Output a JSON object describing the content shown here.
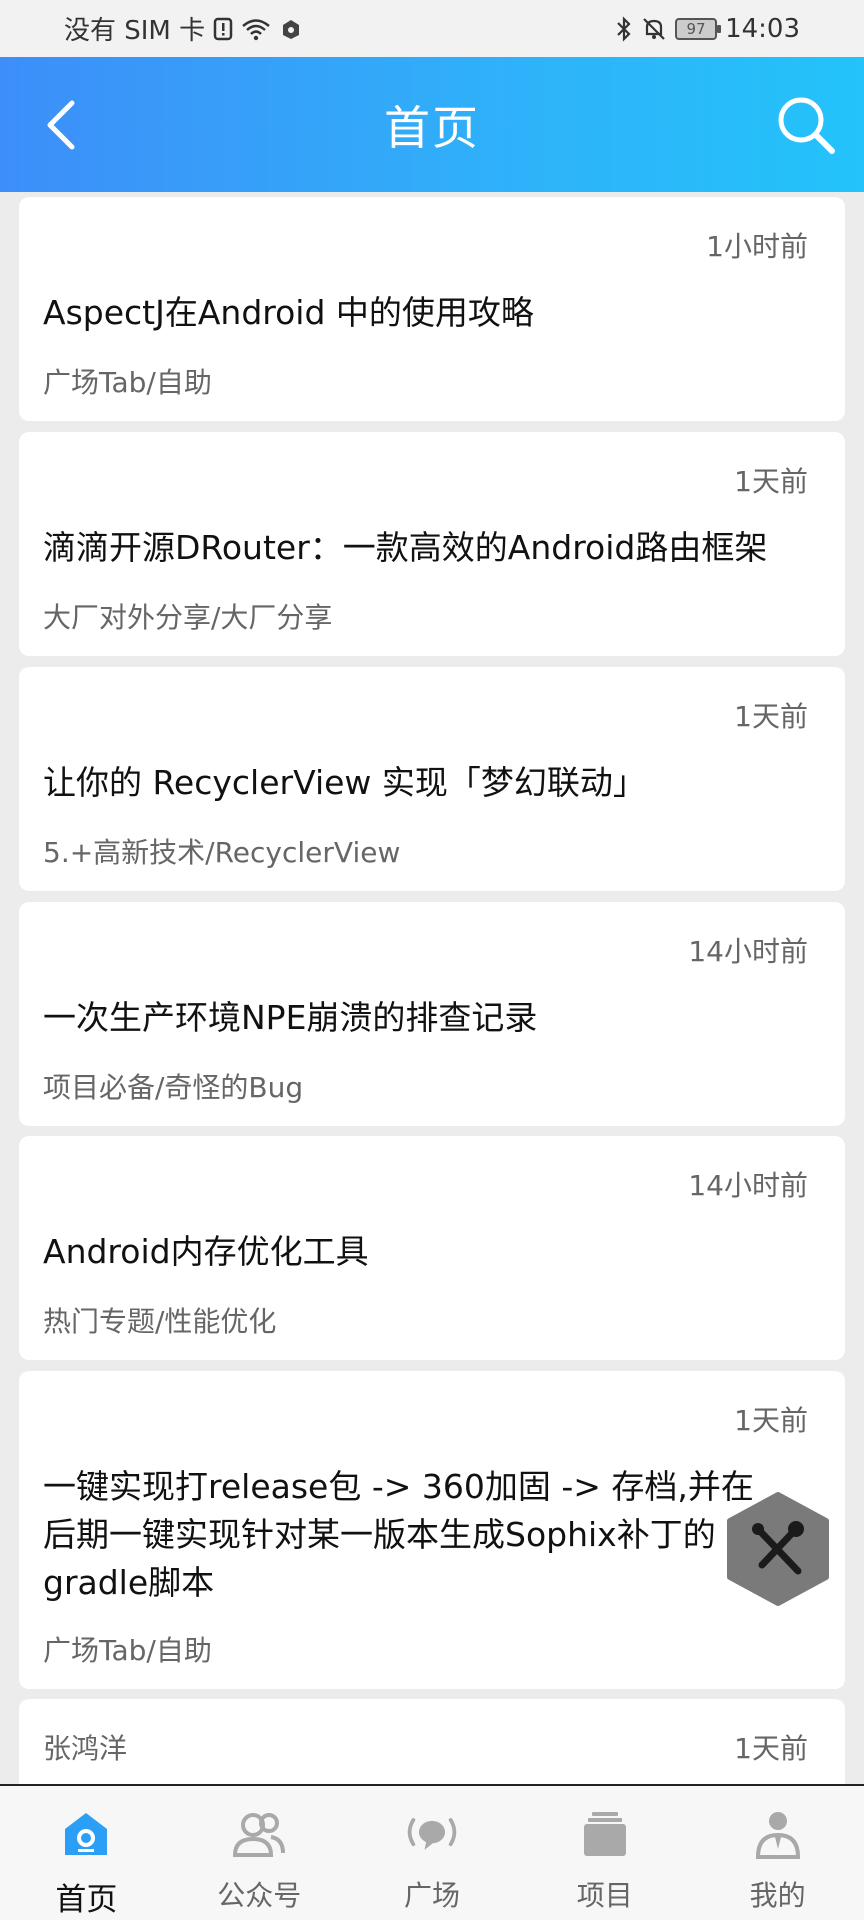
{
  "status_bar": {
    "carrier": "没有 SIM 卡",
    "battery": "97",
    "time": "14:03"
  },
  "header": {
    "title": "首页",
    "back_icon": "chevron-left-icon",
    "search_icon": "search-icon"
  },
  "colors": {
    "header_gradient_start": "#3d8ef9",
    "header_gradient_end": "#23c3fb",
    "nav_active": "#2b9ff5",
    "nav_inactive": "#a9a9a9",
    "fab": "#7a7a7a"
  },
  "feed": {
    "articles": [
      {
        "time": "1小时前",
        "title": "AspectJ在Android 中的使用攻略",
        "category": "广场Tab/自助"
      },
      {
        "time": "1天前",
        "title": "滴滴开源DRouter：一款高效的Android路由框架",
        "category": "大厂对外分享/大厂分享"
      },
      {
        "time": "1天前",
        "title": "让你的 RecyclerView 实现「梦幻联动」",
        "category": "5.+高新技术/RecyclerView"
      },
      {
        "time": "14小时前",
        "title": "一次生产环境NPE崩溃的排查记录",
        "category": "项目必备/奇怪的Bug"
      },
      {
        "time": "14小时前",
        "title": "Android内存优化工具",
        "category": "热门专题/性能优化"
      },
      {
        "time": "1天前",
        "title": "一键实现打release包 -> 360加固 -> 存档,并在后期一键实现针对某一版本生成Sophix补丁的gradle脚本",
        "category": "广场Tab/自助"
      },
      {
        "author": "张鸿洋",
        "time": "1天前"
      }
    ]
  },
  "fab": {
    "icon": "tools-icon"
  },
  "bottom_nav": {
    "items": [
      {
        "label": "首页",
        "icon": "home-icon",
        "active": true
      },
      {
        "label": "公众号",
        "icon": "people-icon",
        "active": false
      },
      {
        "label": "广场",
        "icon": "broadcast-icon",
        "active": false
      },
      {
        "label": "项目",
        "icon": "folder-icon",
        "active": false
      },
      {
        "label": "我的",
        "icon": "user-icon",
        "active": false
      }
    ]
  }
}
